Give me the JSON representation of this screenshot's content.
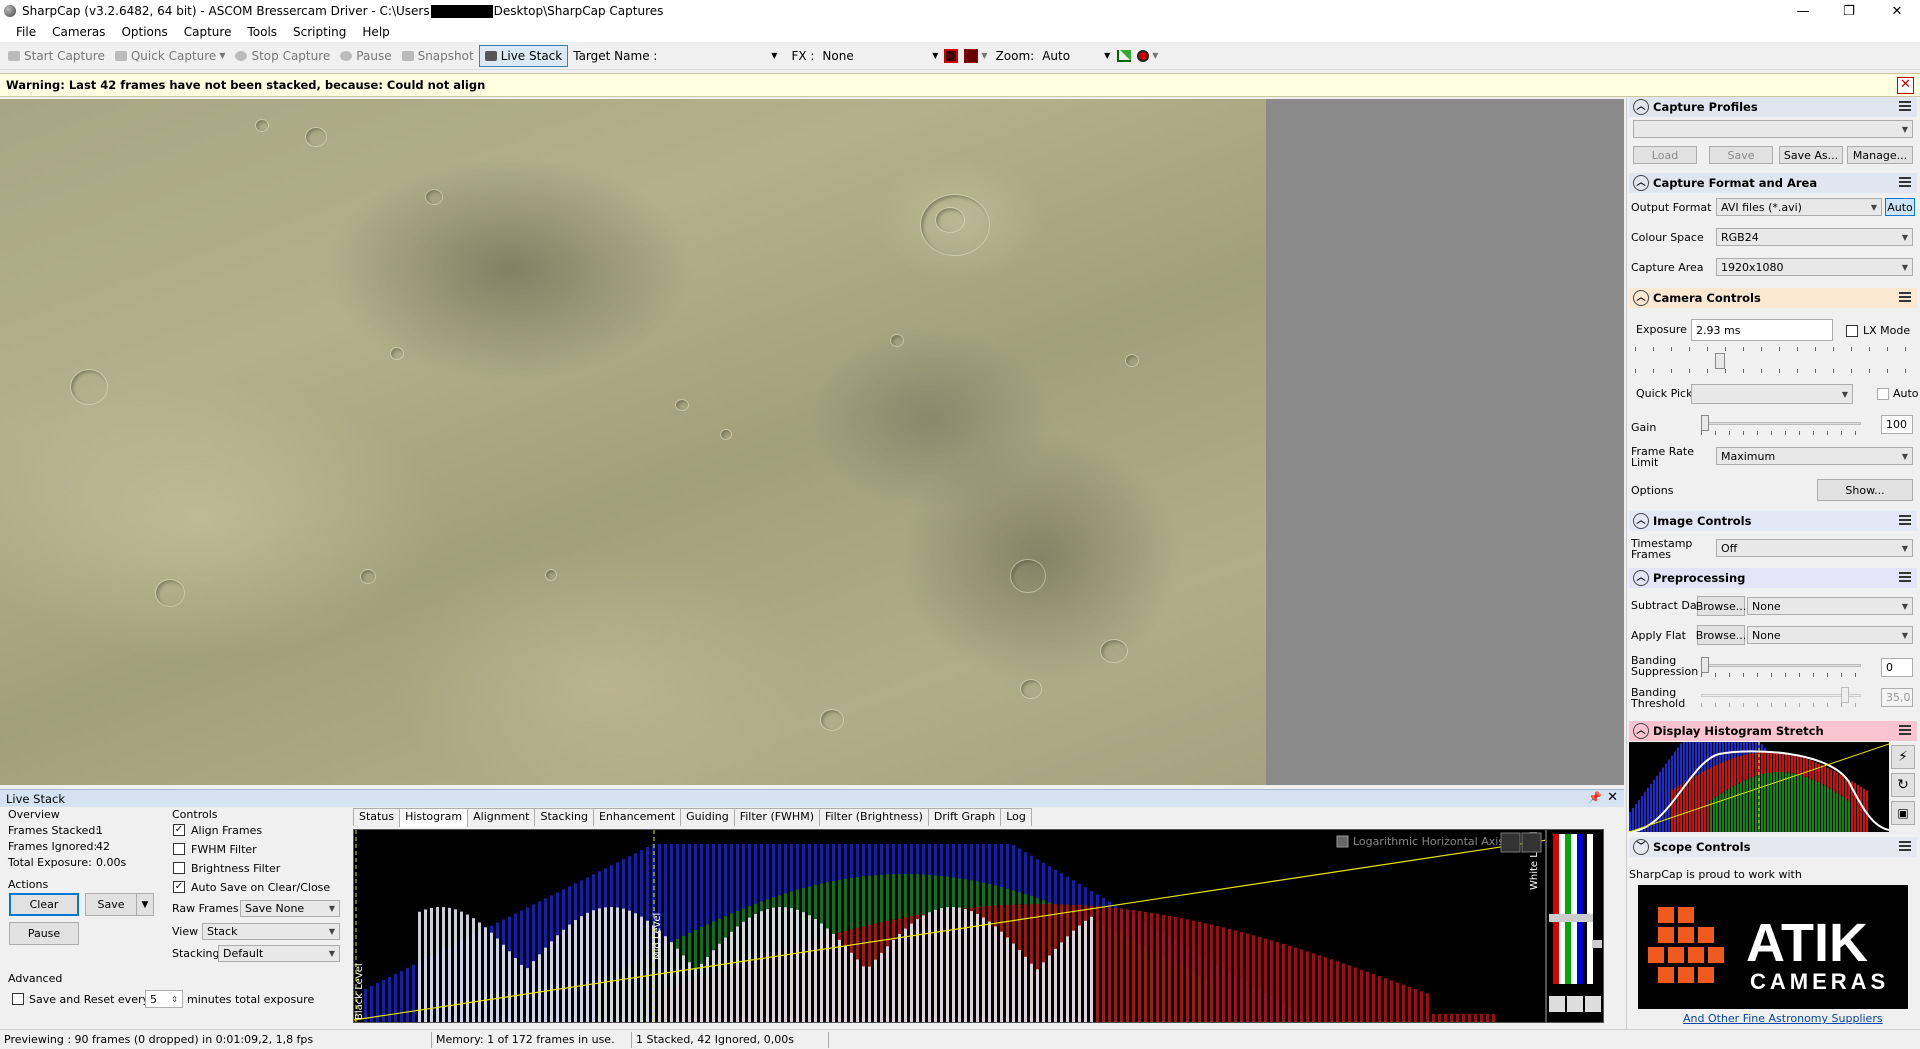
{
  "window": {
    "title_prefix": "SharpCap (v3.2.6482, 64 bit) - ASCOM Bressercam Driver - C:\\Users",
    "title_suffix": "Desktop\\SharpCap Captures",
    "minimize": "—",
    "maximize": "❐",
    "close": "✕"
  },
  "menu": [
    "File",
    "Cameras",
    "Options",
    "Capture",
    "Tools",
    "Scripting",
    "Help"
  ],
  "toolbar": {
    "start_capture": "Start Capture",
    "quick_capture": "Quick Capture",
    "stop_capture": "Stop Capture",
    "pause": "Pause",
    "snapshot": "Snapshot",
    "live_stack": "Live Stack",
    "target_name_label": "Target Name :",
    "target_name_value": "",
    "fx_label": "FX :",
    "fx_value": "None",
    "zoom_label": "Zoom:",
    "zoom_value": "Auto"
  },
  "warning": {
    "text": "Warning: Last 42 frames have not been stacked, because: Could not align",
    "close": "✕"
  },
  "live_stack": {
    "title": "Live Stack",
    "pin": "📌",
    "close": "✕",
    "overview_label": "Overview",
    "frames_stacked_label": "Frames Stacked:",
    "frames_stacked_value": "1",
    "frames_ignored_label": "Frames Ignored:",
    "frames_ignored_value": "42",
    "total_exposure_label": "Total Exposure:",
    "total_exposure_value": "0.00s",
    "actions_label": "Actions",
    "clear_button": "Clear",
    "save_button": "Save",
    "pause_button": "Pause",
    "advanced_label": "Advanced",
    "save_reset_label": "Save and Reset every",
    "save_reset_minutes": "5",
    "minutes_label": "minutes total exposure",
    "controls_label": "Controls",
    "align_frames": "Align Frames",
    "align_frames_checked": true,
    "fwhm_filter": "FWHM Filter",
    "fwhm_filter_checked": false,
    "brightness_filter": "Brightness Filter",
    "brightness_filter_checked": false,
    "auto_save": "Auto Save on Clear/Close",
    "auto_save_checked": true,
    "raw_frames_label": "Raw Frames",
    "raw_frames_value": "Save None",
    "view_label": "View",
    "view_value": "Stack",
    "stacking_label": "Stacking",
    "stacking_value": "Default",
    "tabs": [
      "Status",
      "Histogram",
      "Alignment",
      "Stacking",
      "Enhancement",
      "Guiding",
      "Filter (FWHM)",
      "Filter (Brightness)",
      "Drift Graph",
      "Log"
    ],
    "active_tab": "Histogram",
    "histogram": {
      "log_axis_label": "Logarithmic Horizontal Axis",
      "black_level": "Black Level",
      "mid_level": "Mid Level",
      "white_level": "White Level"
    }
  },
  "status_bar": {
    "previewing": "Previewing : 90 frames (0 dropped) in 0:01:09,2, 1,8 fps",
    "memory": "Memory: 1 of 172 frames in use.",
    "stack_status": "1 Stacked, 42 Ignored, 0,00s"
  },
  "right_panel": {
    "capture_profiles": {
      "title": "Capture Profiles",
      "profile_value": "",
      "load": "Load",
      "save": "Save",
      "save_as": "Save As...",
      "manage": "Manage..."
    },
    "capture_format": {
      "title": "Capture Format and Area",
      "output_format_label": "Output Format",
      "output_format_value": "AVI files (*.avi)",
      "auto": "Auto",
      "colour_space_label": "Colour Space",
      "colour_space_value": "RGB24",
      "capture_area_label": "Capture Area",
      "capture_area_value": "1920x1080"
    },
    "camera_controls": {
      "title": "Camera Controls",
      "exposure_label": "Exposure",
      "exposure_value": "2.93 ms",
      "lx_mode": "LX Mode",
      "quick_picks_label": "Quick Picks",
      "quick_picks_value": "",
      "auto": "Auto",
      "gain_label": "Gain",
      "gain_value": "100",
      "frame_rate_label_1": "Frame Rate",
      "frame_rate_label_2": "Limit",
      "frame_rate_value": "Maximum",
      "options_label": "Options",
      "show_button": "Show..."
    },
    "image_controls": {
      "title": "Image Controls",
      "timestamp_label_1": "Timestamp",
      "timestamp_label_2": "Frames",
      "timestamp_value": "Off"
    },
    "preprocessing": {
      "title": "Preprocessing",
      "subtract_dark_label": "Subtract Dark",
      "browse": "Browse...",
      "subtract_dark_value": "None",
      "apply_flat_label": "Apply Flat",
      "apply_flat_value": "None",
      "banding_supp_label_1": "Banding",
      "banding_supp_label_2": "Suppression",
      "banding_supp_value": "0",
      "banding_thresh_label_1": "Banding",
      "banding_thresh_label_2": "Threshold",
      "banding_thresh_value": "35,0"
    },
    "display_histogram": {
      "title": "Display Histogram Stretch"
    },
    "scope_controls": {
      "title": "Scope Controls"
    },
    "sponsor_text": "SharpCap is proud to work with",
    "atik_line1": "ATIK",
    "atik_line2": "CAMERAS",
    "suppliers_link": "And Other Fine Astronomy Suppliers"
  },
  "colors": {
    "warning_bg": "#ffffe1",
    "section_capture_profiles": "#dfe6ef",
    "section_camera_controls": "#fbe8d3",
    "section_image_controls": "#e3e8f7",
    "section_preprocessing": "#e4e3f7",
    "section_display_histogram": "#f9c4cf",
    "section_scope_controls": "#e3e8f1",
    "atik_orange": "#f05a1e"
  }
}
